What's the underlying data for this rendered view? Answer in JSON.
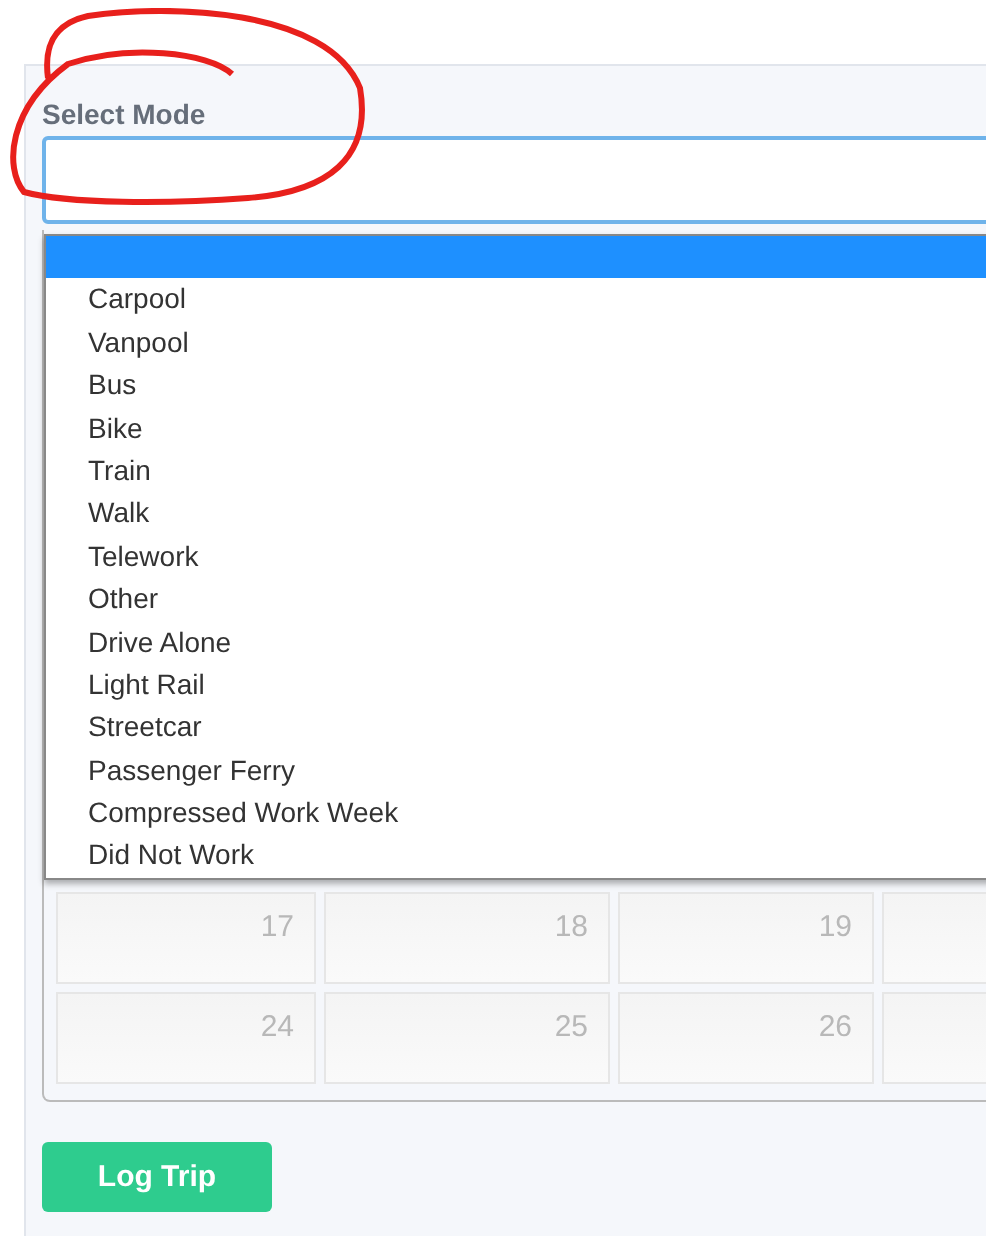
{
  "form": {
    "label": "Select Mode"
  },
  "dropdown": {
    "options": [
      {
        "selected": true
      },
      {
        "label": "Carpool",
        "selected": false
      },
      {
        "label": "Vanpool",
        "selected": false
      },
      {
        "label": "Bus",
        "selected": false
      },
      {
        "label": "Bike",
        "selected": false
      },
      {
        "label": "Train",
        "selected": false
      },
      {
        "label": "Walk",
        "selected": false
      },
      {
        "label": "Telework",
        "selected": false
      },
      {
        "label": "Other",
        "selected": false
      },
      {
        "label": "Drive Alone",
        "selected": false
      },
      {
        "label": "Light Rail",
        "selected": false
      },
      {
        "label": "Streetcar",
        "selected": false
      },
      {
        "label": "Passenger Ferry",
        "selected": false
      },
      {
        "label": "Compressed Work Week",
        "selected": false
      },
      {
        "label": "Did Not Work",
        "selected": false
      }
    ]
  },
  "calendar": {
    "weeks": [
      {
        "days": [
          {
            "day": "17"
          },
          {
            "day": "18"
          },
          {
            "day": "19"
          }
        ]
      },
      {
        "days": [
          {
            "day": "24"
          },
          {
            "day": "25"
          },
          {
            "day": "26"
          }
        ]
      }
    ]
  },
  "button": {
    "label": "Log Trip"
  }
}
